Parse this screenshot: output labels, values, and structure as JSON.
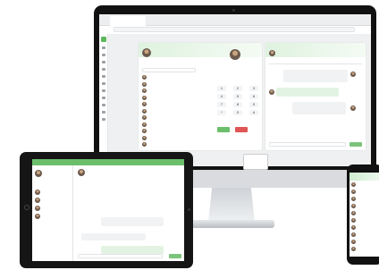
{
  "desktop": {
    "tab_label": "",
    "url": "",
    "contacts_panel": {
      "title": "",
      "user_name": "",
      "user_status": "",
      "contacts": [
        "",
        "",
        "",
        "",
        "",
        "",
        "",
        "",
        "",
        "",
        "",
        "",
        "",
        "",
        ""
      ]
    },
    "dialer": {
      "contact_name": "",
      "contact_sub": "",
      "keys": [
        "1",
        "2",
        "3",
        "4",
        "5",
        "6",
        "7",
        "8",
        "9",
        "*",
        "0",
        "#"
      ],
      "call_color": "#6bbf6b",
      "hangup_color": "#e05555"
    },
    "chat_panel": {
      "title": "",
      "contact_name": "",
      "tabs": [
        "",
        "",
        ""
      ],
      "messages": [
        "",
        "",
        "",
        ""
      ],
      "send_label": ""
    },
    "corner_popup": ""
  },
  "tablet": {
    "header_title": "",
    "contact_name": "",
    "contact_sub": "",
    "sidebar_items": [
      "",
      "",
      "",
      ""
    ],
    "messages": [
      "",
      "",
      ""
    ],
    "send_label": ""
  },
  "phone": {
    "header": "",
    "rows": [
      "",
      "",
      "",
      "",
      "",
      "",
      "",
      "",
      "",
      ""
    ]
  },
  "colors": {
    "accent": "#6bbf6b",
    "accent_light": "#dff2df",
    "danger": "#e05555"
  }
}
